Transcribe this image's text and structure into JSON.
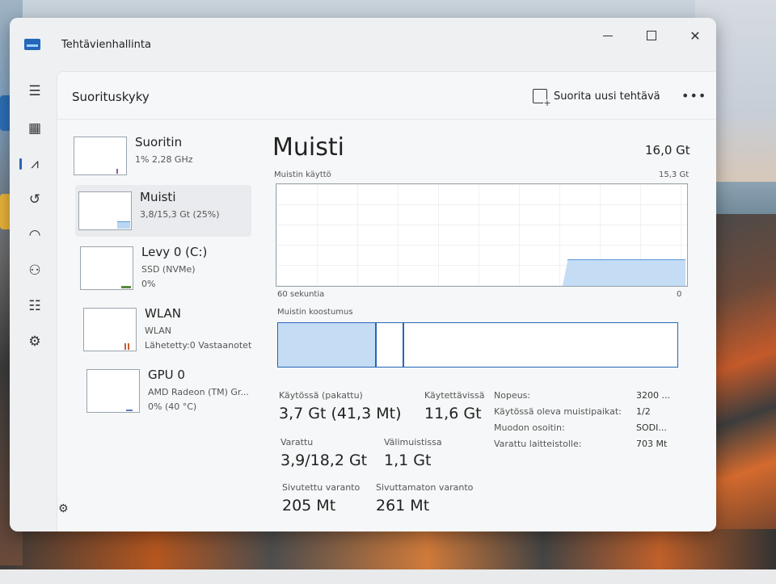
{
  "window": {
    "title": "Tehtävienhallinta"
  },
  "header": {
    "page_title": "Suorituskyky",
    "run_task_label": "Suorita uusi tehtävä",
    "more_label": "•••"
  },
  "rail": {
    "items": [
      {
        "icon": "hamburger-menu-icon"
      },
      {
        "icon": "processes-icon"
      },
      {
        "icon": "performance-icon",
        "active": true
      },
      {
        "icon": "app-history-icon"
      },
      {
        "icon": "startup-apps-icon"
      },
      {
        "icon": "users-icon"
      },
      {
        "icon": "details-icon"
      },
      {
        "icon": "services-icon"
      }
    ],
    "settings_icon": "settings-icon"
  },
  "perf_list": [
    {
      "name": "Suoritin",
      "sub1": "1% 2,28 GHz",
      "sub2": "",
      "selected": false
    },
    {
      "name": "Muisti",
      "sub1": "3,8/15,3 Gt (25%)",
      "sub2": "",
      "selected": true
    },
    {
      "name": "Levy 0 (C:)",
      "sub1": "SSD (NVMe)",
      "sub2": "0%",
      "selected": false
    },
    {
      "name": "WLAN",
      "sub1": "WLAN",
      "sub2": "Lähetetty:0 Vastaanotet",
      "selected": false
    },
    {
      "name": "GPU 0",
      "sub1": "AMD Radeon (TM) Gr...",
      "sub2": "0% (40 °C)",
      "selected": false
    }
  ],
  "detail": {
    "title": "Muisti",
    "total": "16,0 Gt",
    "usage_label": "Muistin käyttö",
    "usage_max": "15,3 Gt",
    "axis_left": "60 sekuntia",
    "axis_right": "0",
    "composition_label": "Muistin koostumus",
    "usage_level": 0.25,
    "stats": {
      "in_use_label": "Käytössä (pakattu)",
      "in_use_value": "3,7 Gt (41,3 Mt)",
      "available_label": "Käytettävissä",
      "available_value": "11,6 Gt",
      "committed_label": "Varattu",
      "committed_value": "3,9/18,2 Gt",
      "cached_label": "Välimuistissa",
      "cached_value": "1,1 Gt",
      "paged_label": "Sivutettu varanto",
      "paged_value": "205 Mt",
      "nonpaged_label": "Sivuttamaton varanto",
      "nonpaged_value": "261 Mt"
    },
    "kv": [
      {
        "key": "Nopeus:",
        "value": "3200 ..."
      },
      {
        "key": "Käytössä oleva muistipaikat:",
        "value": "1/2"
      },
      {
        "key": "Muodon osoitin:",
        "value": "SODI..."
      },
      {
        "key": "Varattu laitteistolle:",
        "value": "703 Mt"
      }
    ]
  }
}
